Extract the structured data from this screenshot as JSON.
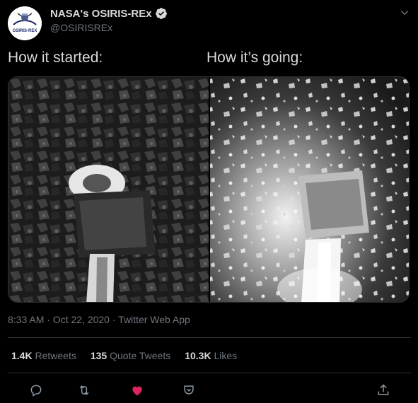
{
  "tweet": {
    "display_name": "NASA's OSIRIS-REx",
    "handle": "@OSIRISREx",
    "caption_left": "How it started:",
    "caption_right": "How it’s going:",
    "timestamp": "8:33 AM · Oct 22, 2020 · Twitter Web App"
  },
  "avatar": {
    "logo_text": "OSIRIS-REX"
  },
  "stats": [
    {
      "number": "1.4K",
      "label": "Retweets"
    },
    {
      "number": "135",
      "label": "Quote Tweets"
    },
    {
      "number": "10.3K",
      "label": "Likes"
    }
  ],
  "icons": {
    "verified": "verified-badge-icon",
    "caret": "chevron-down-icon",
    "reply": "reply-icon",
    "retweet": "retweet-icon",
    "like": "heart-icon",
    "share": "share-icon",
    "bookmark": "bookmark-icon"
  },
  "colors": {
    "background": "#000000",
    "text_primary": "#d9d9d9",
    "text_secondary": "#6e767d",
    "like_active": "#e0245e",
    "divider": "#2f3336"
  }
}
